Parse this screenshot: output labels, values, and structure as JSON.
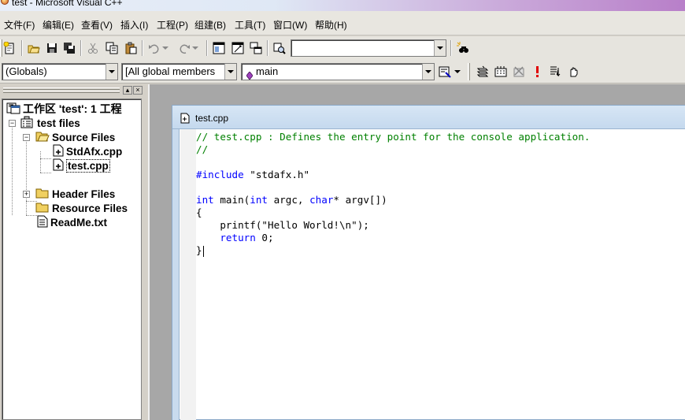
{
  "window": {
    "title": "test - Microsoft Visual C++"
  },
  "menu": [
    {
      "label": "文件(F)"
    },
    {
      "label": "编辑(E)"
    },
    {
      "label": "查看(V)"
    },
    {
      "label": "插入(I)"
    },
    {
      "label": "工程(P)"
    },
    {
      "label": "组建(B)"
    },
    {
      "label": "工具(T)"
    },
    {
      "label": "窗口(W)"
    },
    {
      "label": "帮助(H)"
    }
  ],
  "toolbar": {
    "find_combo_value": "",
    "scope_combo": "(Globals)",
    "members_combo": "[All global members",
    "function_combo": "main"
  },
  "workspace": {
    "title": "工作区 'test': 1 工程",
    "project": "test files",
    "source_folder": "Source Files",
    "files": [
      "StdAfx.cpp",
      "test.cpp"
    ],
    "header_folder": "Header Files",
    "resource_folder": "Resource Files",
    "readme": "ReadMe.txt"
  },
  "editor": {
    "filename": "test.cpp",
    "lines": [
      [
        {
          "t": "// test.cpp : Defines the entry point for the console application.",
          "c": "com"
        }
      ],
      [
        {
          "t": "//",
          "c": "com"
        }
      ],
      [],
      [
        {
          "t": "#include",
          "c": "kw"
        },
        {
          "t": " \"stdafx.h\"",
          "c": "tx"
        }
      ],
      [],
      [
        {
          "t": "int",
          "c": "kw"
        },
        {
          "t": " main(",
          "c": "tx"
        },
        {
          "t": "int",
          "c": "kw"
        },
        {
          "t": " argc, ",
          "c": "tx"
        },
        {
          "t": "char",
          "c": "kw"
        },
        {
          "t": "* argv[])",
          "c": "tx"
        }
      ],
      [
        {
          "t": "{",
          "c": "tx"
        }
      ],
      [
        {
          "t": "    printf(\"Hello World!\\n\");",
          "c": "tx"
        }
      ],
      [
        {
          "t": "    ",
          "c": "tx"
        },
        {
          "t": "return",
          "c": "kw"
        },
        {
          "t": " 0;",
          "c": "tx"
        }
      ],
      [
        {
          "t": "}",
          "c": "tx"
        }
      ]
    ]
  },
  "colors": {
    "comment": "#008000",
    "keyword": "#0000ff",
    "mdi_background": "#a7a7a7"
  }
}
